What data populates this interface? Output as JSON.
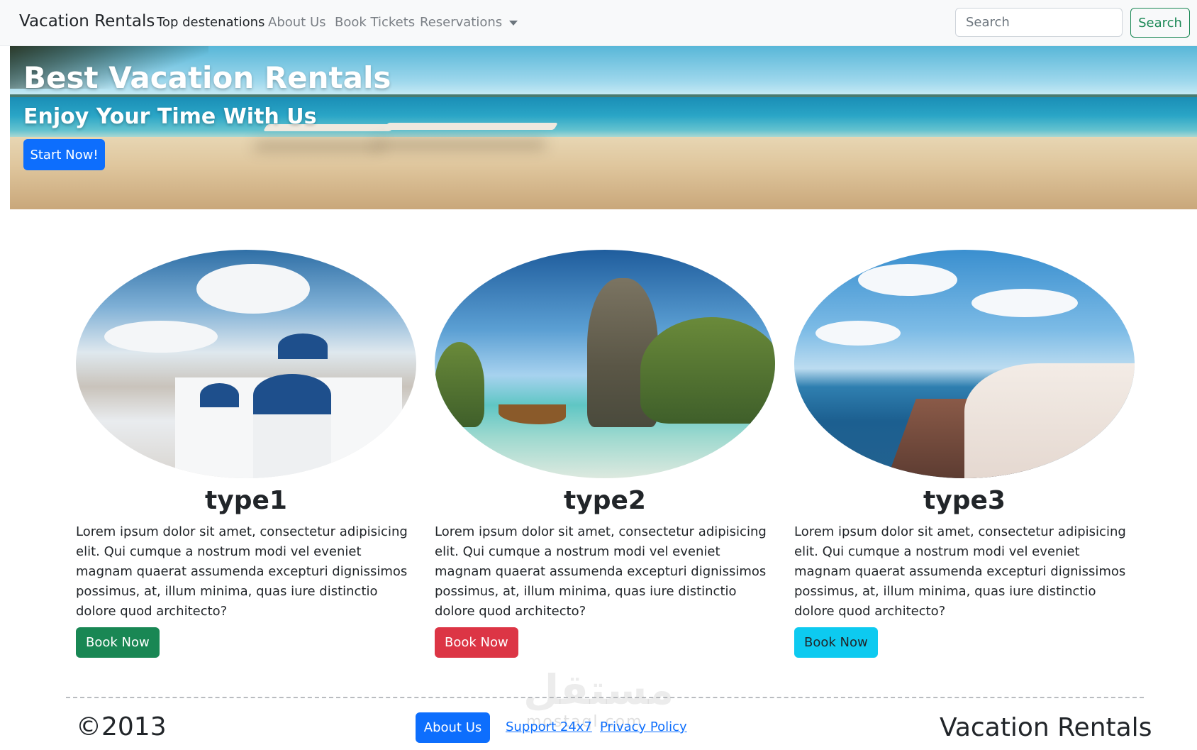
{
  "navbar": {
    "brand": "Vacation Rentals",
    "links": [
      {
        "label": "Top destenations"
      },
      {
        "label": "About Us"
      },
      {
        "label": "Book Tickets"
      },
      {
        "label": "Reservations"
      }
    ],
    "search_placeholder": "Search",
    "search_button": "Search"
  },
  "hero": {
    "title": "Best Vacation Rentals",
    "subtitle": "Enjoy Your Time With Us",
    "button": "Start Now!"
  },
  "cards": [
    {
      "title": "type1",
      "text": "Lorem ipsum dolor sit amet, consectetur adipisicing elit. Qui cumque a nostrum modi vel eveniet magnam quaerat assumenda excepturi dignissimos possimus, at, illum minima, quas iure distinctio dolore quod architecto?",
      "button": "Book Now",
      "button_color": "#198754"
    },
    {
      "title": "type2",
      "text": "Lorem ipsum dolor sit amet, consectetur adipisicing elit. Qui cumque a nostrum modi vel eveniet magnam quaerat assumenda excepturi dignissimos possimus, at, illum minima, quas iure distinctio dolore quod architecto?",
      "button": "Book Now",
      "button_color": "#dc3545"
    },
    {
      "title": "type3",
      "text": "Lorem ipsum dolor sit amet, consectetur adipisicing elit. Qui cumque a nostrum modi vel eveniet magnam quaerat assumenda excepturi dignissimos possimus, at, illum minima, quas iure distinctio dolore quod architecto?",
      "button": "Book Now",
      "button_color": "#0dcaf0"
    }
  ],
  "footer": {
    "copyright": "©2013",
    "about_button": "About Us",
    "support_link": "Support 24x7",
    "privacy_link": "Privacy Policy",
    "brand": "Vacation Rentals"
  },
  "watermark": {
    "arabic": "مستقل",
    "latin": "mostaql.com"
  },
  "colors": {
    "primary": "#0d6efd",
    "success": "#198754",
    "danger": "#dc3545",
    "info": "#0dcaf0"
  }
}
